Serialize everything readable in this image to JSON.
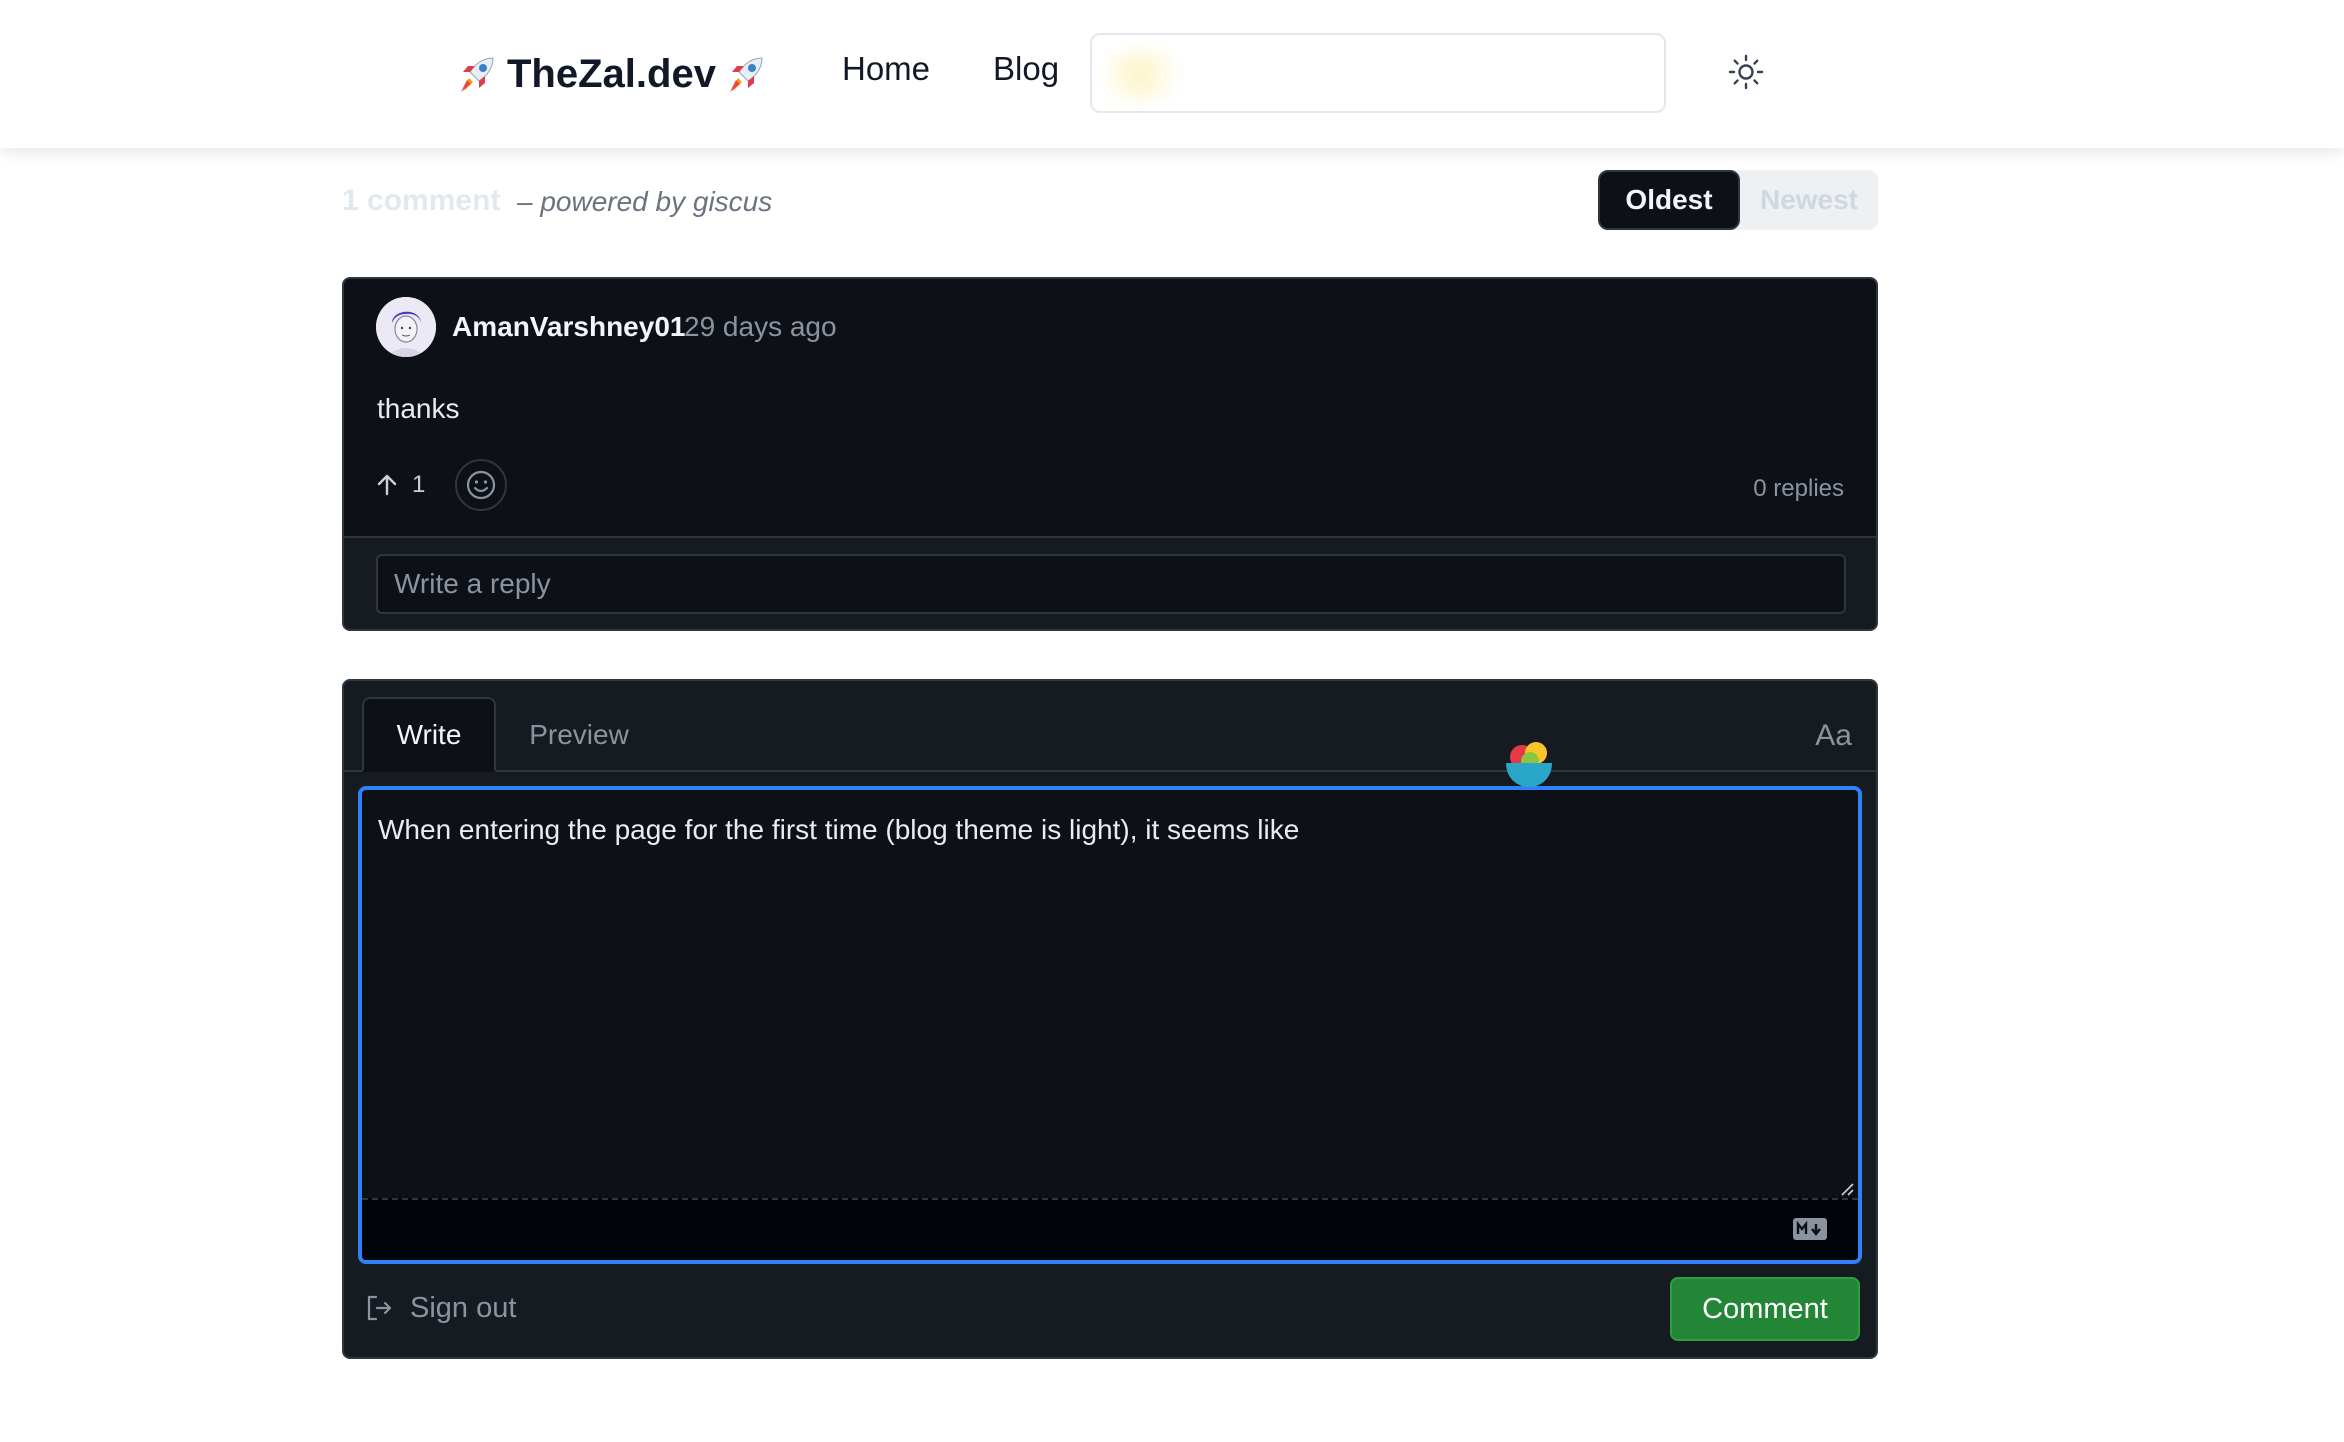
{
  "header": {
    "logo_text": "TheZal.dev",
    "nav": {
      "home": "Home",
      "blog": "Blog"
    },
    "search": {
      "placeholder": ""
    },
    "theme_toggle_icon": "sun-icon"
  },
  "comments_meta": {
    "count_label": "1 comment",
    "powered_by": "– powered by giscus",
    "sort": {
      "oldest": "Oldest",
      "newest": "Newest",
      "selected": "Oldest"
    }
  },
  "comment": {
    "author": "AmanVarshney01",
    "timestamp": "29 days ago",
    "body": "thanks",
    "upvotes": "1",
    "replies": "0 replies",
    "reply_placeholder": "Write a reply"
  },
  "form": {
    "tabs": {
      "write": "Write",
      "preview": "Preview"
    },
    "font_toggle": "Aa",
    "text": "When entering the page for the first time (blog theme is light), it seems like",
    "sign_out": "Sign out",
    "submit": "Comment"
  },
  "colors": {
    "accent_blue": "#2f81f7",
    "button_green": "#238636",
    "card_bg": "#0d1117",
    "border": "#30363d"
  }
}
